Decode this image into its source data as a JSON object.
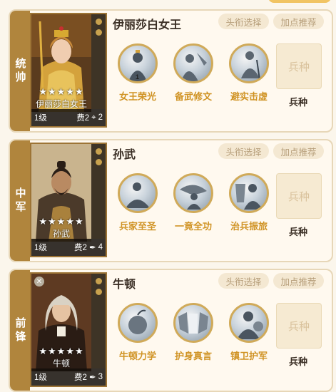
{
  "cards": [
    {
      "position": "统帅",
      "general_name": "伊丽莎白女王",
      "portrait_name": "伊丽莎白女王",
      "stars": "★★★★★",
      "level": "1级",
      "cost_label": "费2",
      "extra_count": "2",
      "title_btn": "头衔选择",
      "points_btn": "加点推荐",
      "skills": [
        {
          "name": "女王荣光",
          "icon": "queen-glory-icon",
          "badge": "1"
        },
        {
          "name": "备武修文",
          "icon": "martial-prep-icon"
        },
        {
          "name": "避实击虚",
          "icon": "evade-strike-icon"
        }
      ],
      "troop_box": "兵种",
      "troop_label": "兵种"
    },
    {
      "position": "中军",
      "general_name": "孙武",
      "portrait_name": "孙武",
      "stars": "★★★★★",
      "level": "1级",
      "cost_label": "费2",
      "extra_count": "4",
      "title_btn": "头衔选择",
      "points_btn": "加点推荐",
      "skills": [
        {
          "name": "兵家至圣",
          "icon": "military-sage-icon"
        },
        {
          "name": "一竟全功",
          "icon": "complete-merit-icon"
        },
        {
          "name": "治兵振旅",
          "icon": "troop-rally-icon"
        }
      ],
      "troop_box": "兵种",
      "troop_label": "兵种"
    },
    {
      "position": "前锋",
      "general_name": "牛顿",
      "portrait_name": "牛顿",
      "stars": "★★★★★",
      "level": "1级",
      "cost_label": "费2",
      "extra_count": "3",
      "title_btn": "头衔选择",
      "points_btn": "加点推荐",
      "skills": [
        {
          "name": "牛顿力学",
          "icon": "newton-mechanics-icon"
        },
        {
          "name": "护身真言",
          "icon": "protective-mantra-icon"
        },
        {
          "name": "镇卫护军",
          "icon": "guard-army-icon"
        }
      ],
      "troop_box": "兵种",
      "troop_label": "兵种"
    }
  ]
}
